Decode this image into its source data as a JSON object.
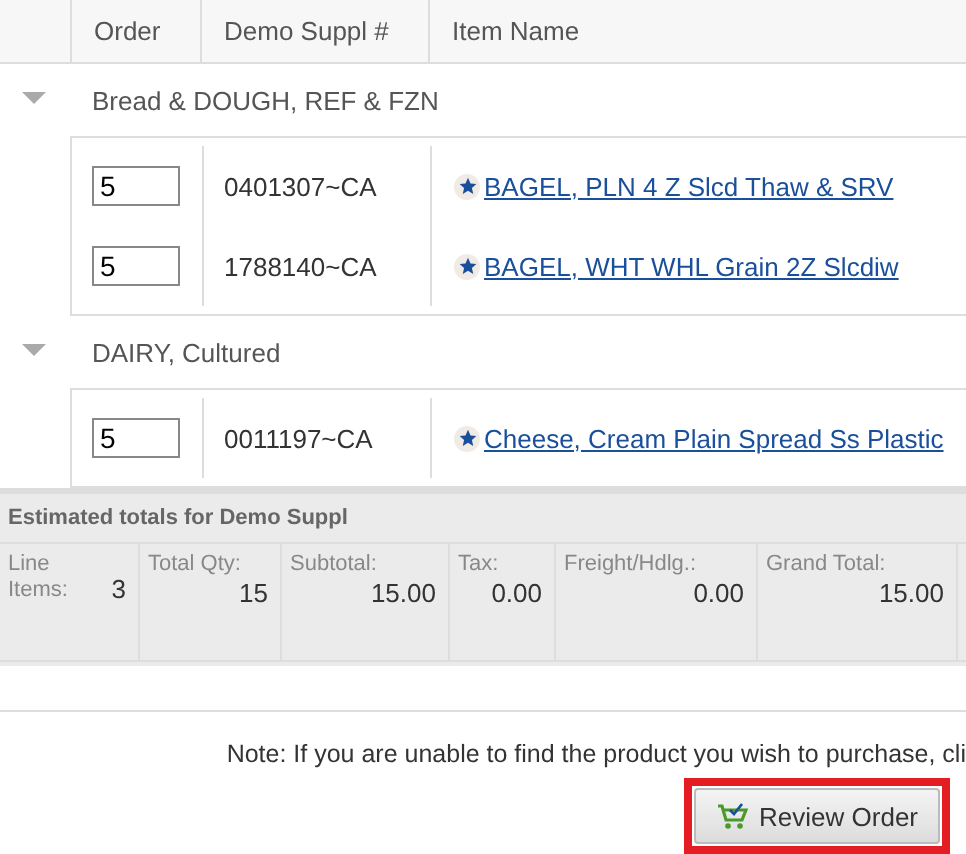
{
  "table": {
    "columns": [
      "Order",
      "Demo Suppl #",
      "Item Name"
    ],
    "groups": [
      {
        "name": "Bread & DOUGH, REF & FZN",
        "expanded": true,
        "items": [
          {
            "qty": "5",
            "code": "0401307~CA",
            "name": "BAGEL, PLN 4 Z Slcd Thaw & SRV",
            "favorite": true
          },
          {
            "qty": "5",
            "code": "1788140~CA",
            "name": "BAGEL, WHT WHL Grain 2Z Slcdiw",
            "favorite": true
          }
        ]
      },
      {
        "name": "DAIRY, Cultured",
        "expanded": true,
        "items": [
          {
            "qty": "5",
            "code": "0011197~CA",
            "name": "Cheese, Cream Plain Spread Ss Plastic",
            "favorite": true
          }
        ]
      }
    ]
  },
  "totals": {
    "title": "Estimated totals for Demo Suppl",
    "fields": [
      {
        "label": "Line Items:",
        "value": "3",
        "kind": "inline"
      },
      {
        "label": "Total Qty:",
        "value": "15",
        "kind": "stacked"
      },
      {
        "label": "Subtotal:",
        "value": "15.00",
        "kind": "stacked"
      },
      {
        "label": "Tax:",
        "value": "0.00",
        "kind": "stacked"
      },
      {
        "label": "Freight/Hdlg.:",
        "value": "0.00",
        "kind": "stacked"
      },
      {
        "label": "Grand Total:",
        "value": "15.00",
        "kind": "stacked"
      }
    ]
  },
  "note": "Note: If you are unable to find the product you wish to purchase, cli",
  "review_button": {
    "label": "Review Order",
    "highlighted": true
  }
}
